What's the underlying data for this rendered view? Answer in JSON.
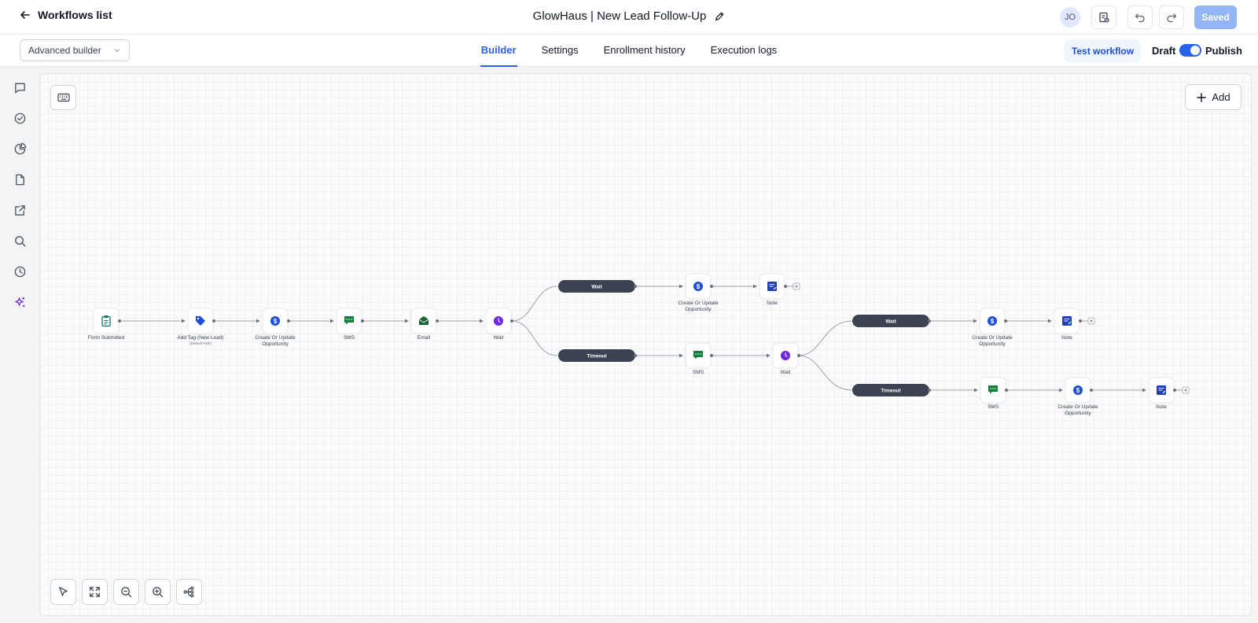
{
  "topbar": {
    "back_label": "Workflows list",
    "workflow_title": "GlowHaus | New Lead Follow-Up",
    "avatar_initials": "JO",
    "saved_label": "Saved"
  },
  "subbar": {
    "builder_mode": "Advanced builder",
    "tabs": [
      {
        "label": "Builder",
        "active": true
      },
      {
        "label": "Settings",
        "active": false
      },
      {
        "label": "Enrollment history",
        "active": false
      },
      {
        "label": "Execution logs",
        "active": false
      }
    ],
    "test_label": "Test workflow",
    "draft_label": "Draft",
    "publish_label": "Publish",
    "publish_toggle_on": true
  },
  "rail": {
    "icons": [
      "chat-icon",
      "check-circle-icon",
      "pie-chart-icon",
      "file-icon",
      "external-link-icon",
      "search-icon",
      "clock-icon",
      "sparkles-icon"
    ]
  },
  "canvas": {
    "add_label": "Add"
  },
  "colors": {
    "accent": "#2563eb",
    "pill": "#3b4353",
    "tag_blue": "#1d4ed8",
    "sms_green": "#15803d",
    "email_green": "#166534",
    "wait_purple": "#6d28d9",
    "note_blue": "#1e40af",
    "form_teal": "#0f766e"
  },
  "flow": {
    "nodes": [
      {
        "id": "n1",
        "label": "Form Submitted",
        "icon": "form-icon"
      },
      {
        "id": "n2",
        "label": "Add Tag (New Lead)",
        "sub": "(Default Path)",
        "icon": "tag-icon"
      },
      {
        "id": "n3",
        "label": "Create Or Update",
        "label2": "Opportunity",
        "icon": "dollar-icon"
      },
      {
        "id": "n4",
        "label": "SMS",
        "icon": "sms-icon"
      },
      {
        "id": "n5",
        "label": "Email",
        "icon": "email-icon"
      },
      {
        "id": "n6",
        "label": "Wait",
        "icon": "wait-icon"
      },
      {
        "id": "n7",
        "label": "Create Or Update",
        "label2": "Opportunity",
        "icon": "dollar-icon"
      },
      {
        "id": "n8",
        "label": "Note",
        "icon": "note-icon"
      },
      {
        "id": "n9",
        "label": "SMS",
        "icon": "sms-icon"
      },
      {
        "id": "n10",
        "label": "Wait",
        "icon": "wait-icon"
      },
      {
        "id": "n11",
        "label": "Create Or Update",
        "label2": "Opportunity",
        "icon": "dollar-icon"
      },
      {
        "id": "n12",
        "label": "Note",
        "icon": "note-icon"
      },
      {
        "id": "n13",
        "label": "SMS",
        "icon": "sms-icon"
      },
      {
        "id": "n14",
        "label": "Create Or Update",
        "label2": "Opportunity",
        "icon": "dollar-icon"
      },
      {
        "id": "n15",
        "label": "Note",
        "icon": "note-icon"
      }
    ],
    "branches": [
      {
        "id": "b1",
        "label": "Wait"
      },
      {
        "id": "b2",
        "label": "Timeout"
      },
      {
        "id": "b3",
        "label": "Wait"
      },
      {
        "id": "b4",
        "label": "Timeout"
      }
    ]
  }
}
